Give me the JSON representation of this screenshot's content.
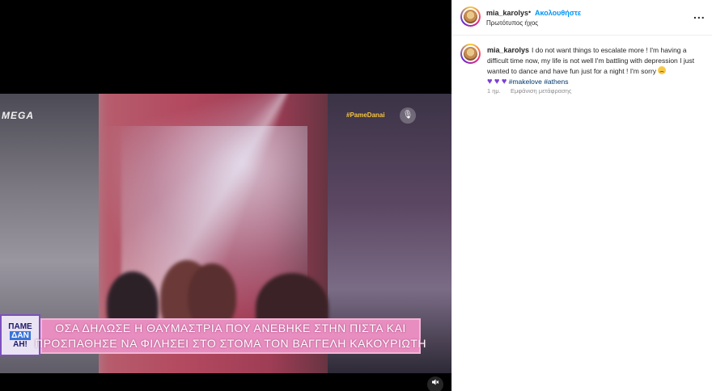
{
  "video": {
    "channel_logo": "MEGA",
    "hashtag_badge": "#PameDanai",
    "show_logo": [
      "ΠΑΜΕ",
      "ΔΑΝ",
      "ΑΗ!"
    ],
    "caption_line1": "ΟΣΑ ΔΗΛΩΣΕ Η ΘΑΥΜΑΣΤΡΙΑ ΠΟΥ ΑΝΕΒΗΚΕ ΣΤΗΝ ΠΙΣΤΑ ΚΑΙ",
    "caption_line2": "ΠΡΟΣΠΑΘΗΣΕ ΝΑ ΦΙΛΗΣΕΙ ΣΤΟ ΣΤΟΜΑ ΤΟΝ ΒΑΓΓΕΛΗ ΚΑΚΟΥΡΙΩΤΗ",
    "mute_icon": "speaker-muted-icon"
  },
  "header": {
    "username": "mia_karolys",
    "separator": "•",
    "follow_label": "Ακολουθήστε",
    "audio_label": "Πρωτότυπος ήχος",
    "more_label": "..."
  },
  "comment": {
    "username": "mia_karolys",
    "text_part1": "I do not want things to escalate more ! I'm having a difficult time now, my life is not well I'm battling with depression I just wanted to dance and have fun just for a night ! I'm sorry",
    "hashtags": [
      "#makelove",
      "#athens"
    ],
    "age": "1 ημ.",
    "translate_label": "Εμφάνιση μετάφρασης"
  },
  "colors": {
    "accent": "#0095f6",
    "hashtag": "#00376b",
    "caption_bg": "#e88dbf",
    "heart": "#7b3fd1"
  }
}
